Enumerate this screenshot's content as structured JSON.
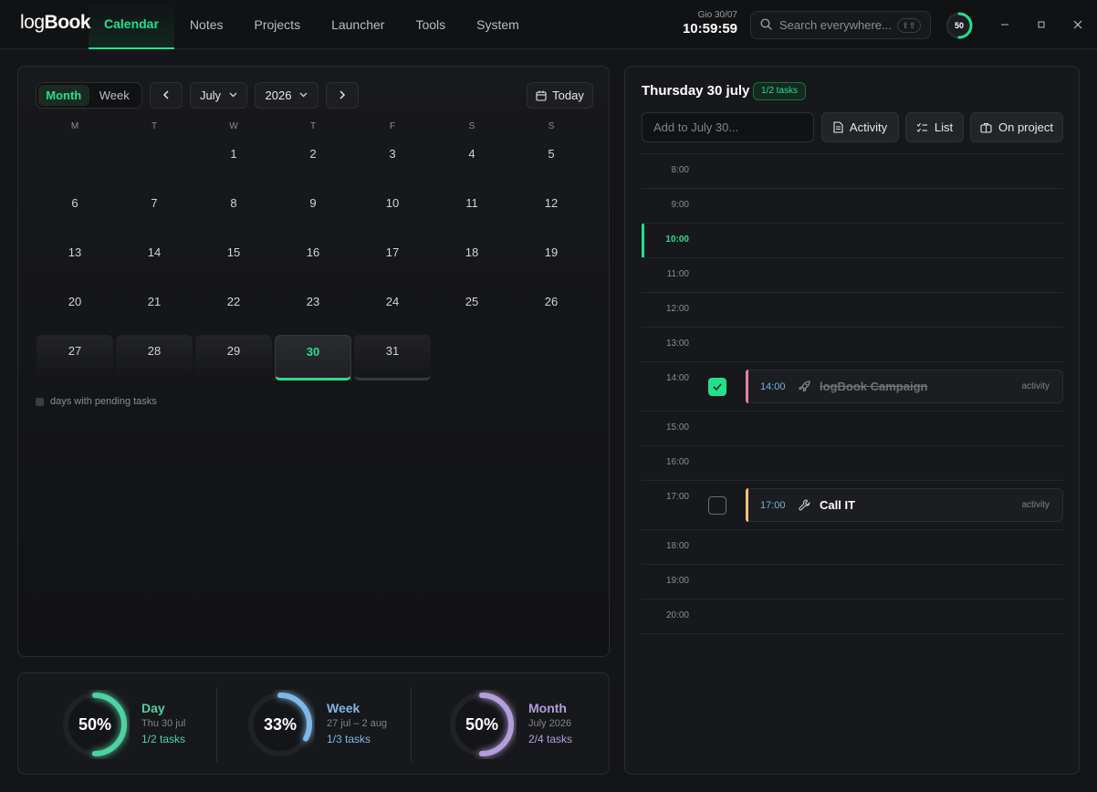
{
  "app": {
    "logo_light": "log",
    "logo_bold": "Book",
    "nav": [
      {
        "label": "Calendar",
        "active": true
      },
      {
        "label": "Notes",
        "active": false
      },
      {
        "label": "Projects",
        "active": false
      },
      {
        "label": "Launcher",
        "active": false
      },
      {
        "label": "Tools",
        "active": false
      },
      {
        "label": "System",
        "active": false
      }
    ],
    "clock_date": "Gio 30/07",
    "clock_time": "10:59:59",
    "search_placeholder": "Search everywhere...",
    "search_shortcut": "⇧⇧",
    "daily_progress": "50",
    "accent_color": "#22e08a"
  },
  "calendar": {
    "view_month": "Month",
    "view_week": "Week",
    "month": "July",
    "year": "2026",
    "today_label": "Today",
    "weekdays": [
      "M",
      "T",
      "W",
      "T",
      "F",
      "S",
      "S"
    ],
    "weeks": [
      [
        "",
        "",
        "1",
        "2",
        "3",
        "4",
        "5"
      ],
      [
        "6",
        "7",
        "8",
        "9",
        "10",
        "11",
        "12"
      ],
      [
        "13",
        "14",
        "15",
        "16",
        "17",
        "18",
        "19"
      ],
      [
        "20",
        "21",
        "22",
        "23",
        "24",
        "25",
        "26"
      ],
      [
        "27",
        "28",
        "29",
        "30",
        "31",
        "",
        ""
      ]
    ],
    "today_day": "30",
    "legend": "days with pending tasks"
  },
  "stats": [
    {
      "percent": "50%",
      "value": 0.5,
      "title": "Day",
      "sub": "Thu 30 jul",
      "count": "1/2 tasks",
      "color": "#4fd1a1"
    },
    {
      "percent": "33%",
      "value": 0.33,
      "title": "Week",
      "sub": "27 jul – 2 aug",
      "count": "1/3 tasks",
      "color": "#7eb8e8"
    },
    {
      "percent": "50%",
      "value": 0.5,
      "title": "Month",
      "sub": "July 2026",
      "count": "2/4 tasks",
      "color": "#b39ddb"
    }
  ],
  "day": {
    "title": "Thursday 30 july",
    "badge": "1/2 tasks",
    "add_placeholder": "Add to July 30...",
    "btn_activity": "Activity",
    "btn_list": "List",
    "btn_project": "On project",
    "slots": [
      "8:00",
      "9:00",
      "10:00",
      "11:00",
      "12:00",
      "13:00",
      "14:00",
      "15:00",
      "16:00",
      "17:00",
      "18:00",
      "19:00",
      "20:00"
    ],
    "current_slot": "10:00",
    "tasks": [
      {
        "time": "14:00",
        "name": "logBook Campaign",
        "tag": "activity",
        "done": true,
        "icon": "rocket-icon",
        "stripe": "#e77fa5"
      },
      {
        "time": "17:00",
        "name": "Call IT",
        "tag": "activity",
        "done": false,
        "icon": "wrench-icon",
        "stripe": "#f2c27a"
      }
    ]
  }
}
